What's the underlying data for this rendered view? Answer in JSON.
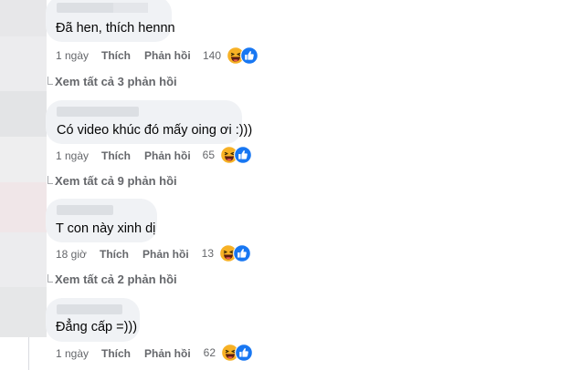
{
  "comments": [
    {
      "text": "Đã hen, thích hennn",
      "time": "1 ngày",
      "like": "Thích",
      "reply": "Phản hồi",
      "reactions": "140",
      "view_replies": "Xem tất cả 3 phản hồi"
    },
    {
      "text": "Có video khúc đó mấy oing ơi :)))",
      "time": "1 ngày",
      "like": "Thích",
      "reply": "Phản hồi",
      "reactions": "65",
      "view_replies": "Xem tất cả 9 phản hồi"
    },
    {
      "text": "T con này xinh dị",
      "time": "18 giờ",
      "like": "Thích",
      "reply": "Phản hồi",
      "reactions": "13",
      "view_replies": "Xem tất cả 2 phản hồi"
    },
    {
      "text": "Đẳng cấp =)))",
      "time": "1 ngày",
      "like": "Thích",
      "reply": "Phản hồi",
      "reactions": "62"
    }
  ],
  "icons": {
    "haha": "haha-reaction-icon",
    "like": "like-reaction-icon",
    "reply_arrow": "reply-arrow-icon"
  },
  "colors": {
    "bubble": "#f0f2f5",
    "meta_text": "#65676b",
    "comment_text": "#050505",
    "like_blue": "#1877f2",
    "haha_yellow": "#f7b125"
  }
}
